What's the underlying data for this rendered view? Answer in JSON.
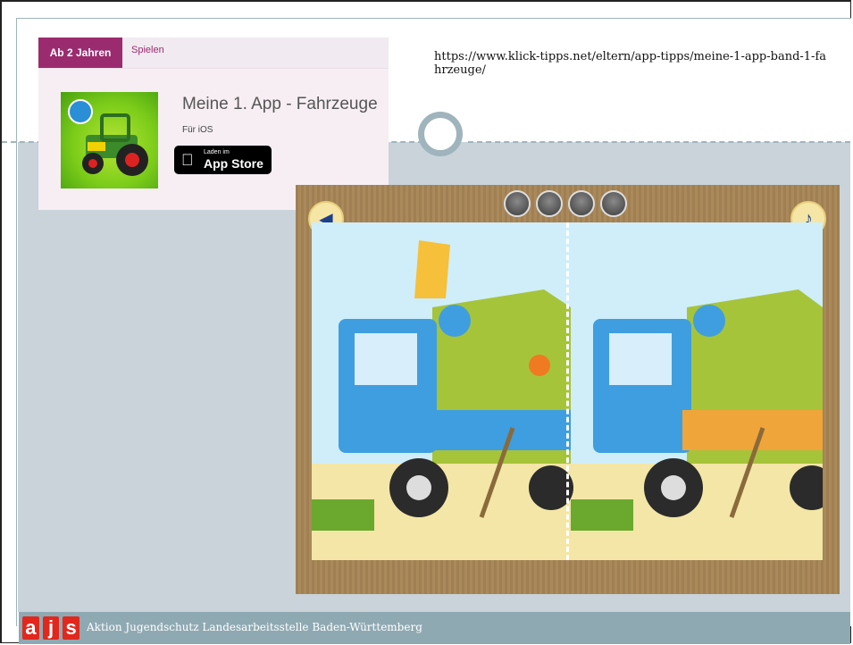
{
  "url": "https://www.klick-tipps.net/eltern/app-tipps/meine-1-app-band-1-fahrzeuge/",
  "card": {
    "tab_age": "Ab 2 Jahren",
    "tab_play": "Spielen",
    "app_title": "Meine 1. App - Fahrzeuge",
    "platform": "Für iOS",
    "store_small": "Laden im",
    "store_big": "App Store"
  },
  "footer": {
    "logo_letters": [
      "a",
      "j",
      "s"
    ],
    "text": "Aktion Jugendschutz Landesarbeitsstelle Baden-Württemberg"
  },
  "colors": {
    "accent": "#9b2b6f",
    "footer_bg": "#8fa9b2",
    "logo_red": "#e2271c"
  },
  "game": {
    "progress_dots": 4,
    "back_icon": "back-arrow-icon",
    "sound_icon": "music-note-icon"
  }
}
